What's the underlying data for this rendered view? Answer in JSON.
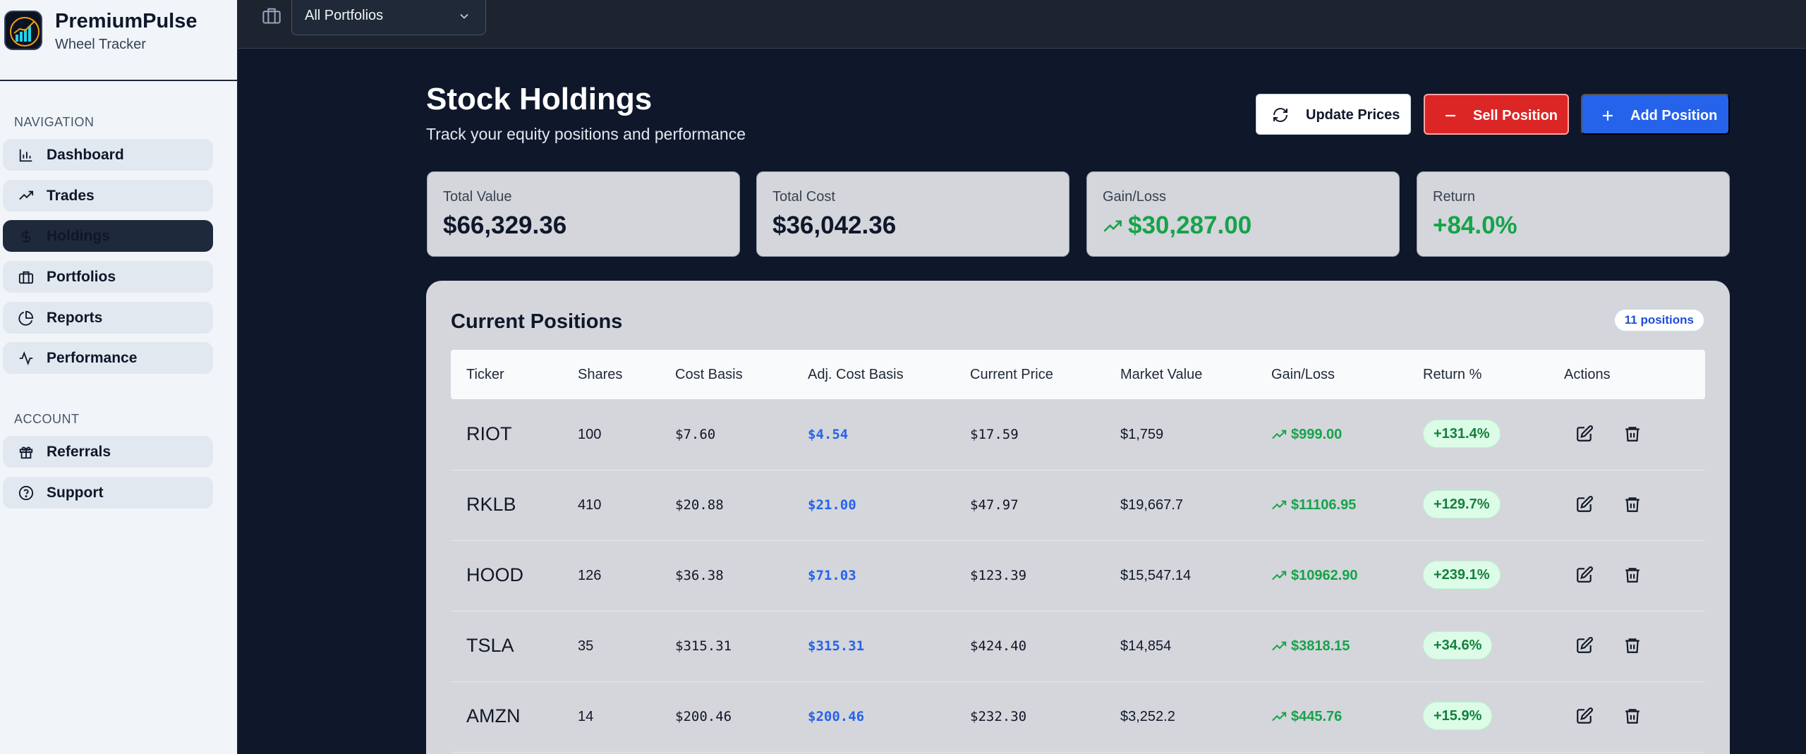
{
  "brand": {
    "name": "PremiumPulse",
    "subtitle": "Wheel Tracker"
  },
  "nav": {
    "section_label": "NAVIGATION",
    "items": [
      {
        "label": "Dashboard",
        "icon": "bar-chart-icon"
      },
      {
        "label": "Trades",
        "icon": "trending-up-icon"
      },
      {
        "label": "Holdings",
        "icon": "dollar-icon",
        "active": true
      },
      {
        "label": "Portfolios",
        "icon": "briefcase-icon"
      },
      {
        "label": "Reports",
        "icon": "pie-chart-icon"
      },
      {
        "label": "Performance",
        "icon": "activity-icon"
      }
    ]
  },
  "account": {
    "section_label": "ACCOUNT",
    "items": [
      {
        "label": "Referrals",
        "icon": "gift-icon"
      },
      {
        "label": "Support",
        "icon": "help-circle-icon"
      }
    ]
  },
  "topbar": {
    "portfolio_value": "All Portfolios"
  },
  "header": {
    "title": "Stock Holdings",
    "subtitle": "Track your equity positions and performance",
    "update_label": "Update Prices",
    "sell_label": "Sell Position",
    "add_label": "Add Position"
  },
  "stats": [
    {
      "label": "Total Value",
      "value": "$66,329.36"
    },
    {
      "label": "Total Cost",
      "value": "$36,042.36"
    },
    {
      "label": "Gain/Loss",
      "value": "$30,287.00"
    },
    {
      "label": "Return",
      "value": "+84.0%"
    }
  ],
  "positions": {
    "title": "Current Positions",
    "count": "11 positions",
    "columns": [
      "Ticker",
      "Shares",
      "Cost Basis",
      "Adj. Cost Basis",
      "Current Price",
      "Market Value",
      "Gain/Loss",
      "Return %",
      "Actions"
    ],
    "rows": [
      {
        "ticker": "RIOT",
        "shares": "100",
        "cost": "$7.60",
        "adj": "$4.54",
        "price": "$17.59",
        "market": "$1,759",
        "gain": "$999.00",
        "ret": "+131.4%"
      },
      {
        "ticker": "RKLB",
        "shares": "410",
        "cost": "$20.88",
        "adj": "$21.00",
        "price": "$47.97",
        "market": "$19,667.7",
        "gain": "$11106.95",
        "ret": "+129.7%"
      },
      {
        "ticker": "HOOD",
        "shares": "126",
        "cost": "$36.38",
        "adj": "$71.03",
        "price": "$123.39",
        "market": "$15,547.14",
        "gain": "$10962.90",
        "ret": "+239.1%"
      },
      {
        "ticker": "TSLA",
        "shares": "35",
        "cost": "$315.31",
        "adj": "$315.31",
        "price": "$424.40",
        "market": "$14,854",
        "gain": "$3818.15",
        "ret": "+34.6%"
      },
      {
        "ticker": "AMZN",
        "shares": "14",
        "cost": "$200.46",
        "adj": "$200.46",
        "price": "$232.30",
        "market": "$3,252.2",
        "gain": "$445.76",
        "ret": "+15.9%"
      }
    ]
  },
  "colors": {
    "accent_blue": "#2563eb",
    "sell_red": "#dc2626",
    "gain_green": "#16a34a",
    "page_bg": "#0f172a"
  }
}
